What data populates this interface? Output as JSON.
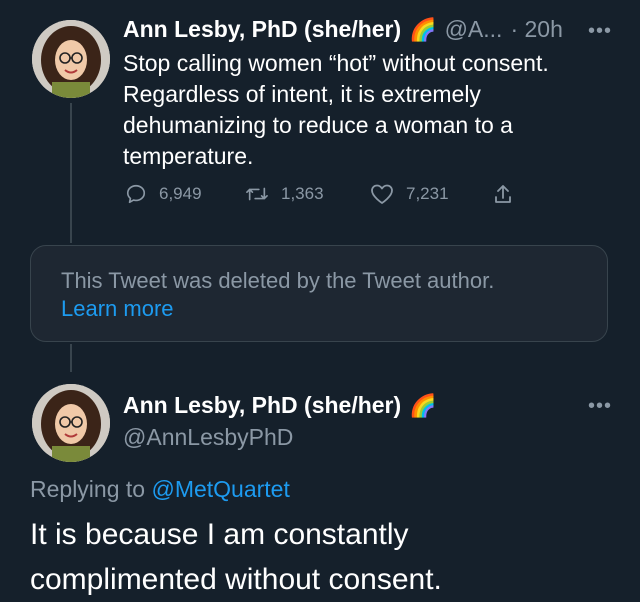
{
  "tweet1": {
    "name": "Ann Lesby, PhD (she/her)",
    "emoji": "🌈",
    "handle_truncated": "@A...",
    "time": "· 20h",
    "more": "•••",
    "text_lines": [
      "Stop calling women “hot” without consent.",
      "Regardless of intent, it is extremely",
      "dehumanizing to reduce a woman to a",
      "temperature."
    ],
    "replies": "6,949",
    "retweets": "1,363",
    "likes": "7,231"
  },
  "deleted": {
    "message": "This Tweet was deleted by the Tweet author.",
    "learn_more": "Learn more"
  },
  "tweet2": {
    "name": "Ann Lesby, PhD (she/her)",
    "emoji": "🌈",
    "handle": "@AnnLesbyPhD",
    "more": "•••",
    "replying_prefix": "Replying to",
    "replying_to": "@MetQuartet",
    "text_lines": [
      "It is because I am constantly",
      "complimented without consent."
    ]
  },
  "colors": {
    "background": "#15202b",
    "muted": "#8b98a5",
    "link": "#1d9bf0"
  }
}
